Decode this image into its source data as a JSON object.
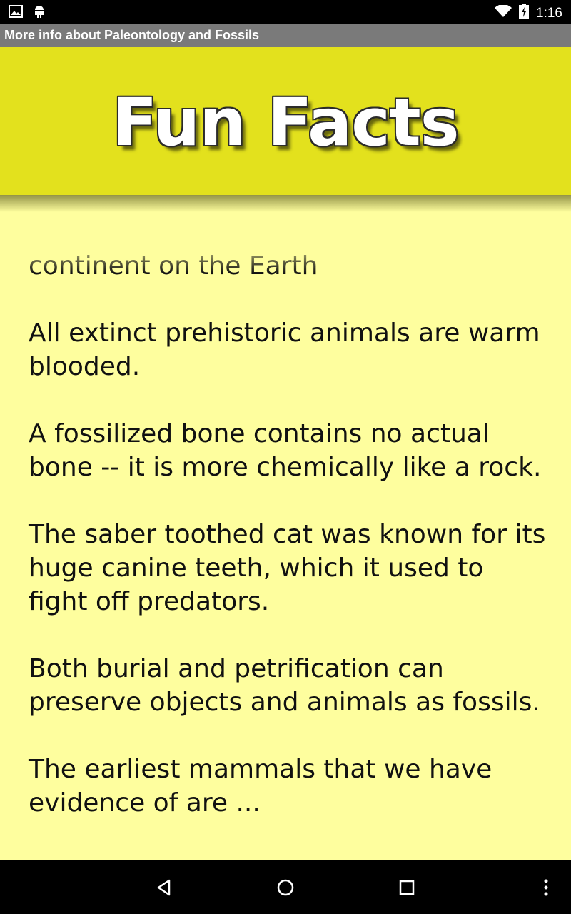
{
  "status_bar": {
    "time": "1:16",
    "icons": [
      "image-icon",
      "android-debug-icon",
      "wifi-icon",
      "battery-icon"
    ]
  },
  "title_bar": {
    "title": "More info about Paleontology and Fossils"
  },
  "banner": {
    "title": "Fun Facts",
    "background": "#e3e11d"
  },
  "content": {
    "background": "#fefe9e",
    "facts": [
      "continent on the Earth",
      " All extinct prehistoric animals are warm blooded.",
      " A fossilized bone contains no actual bone -- it is more chemically like a rock.",
      " The saber toothed cat was known for its huge canine teeth, which it used to fight off predators.",
      " Both burial and petrification can preserve objects and animals as fossils.",
      " The earliest mammals that we have evidence of are ..."
    ]
  },
  "nav_bar": {
    "icons": [
      "back-icon",
      "home-icon",
      "recents-icon",
      "overflow-menu-icon"
    ]
  }
}
